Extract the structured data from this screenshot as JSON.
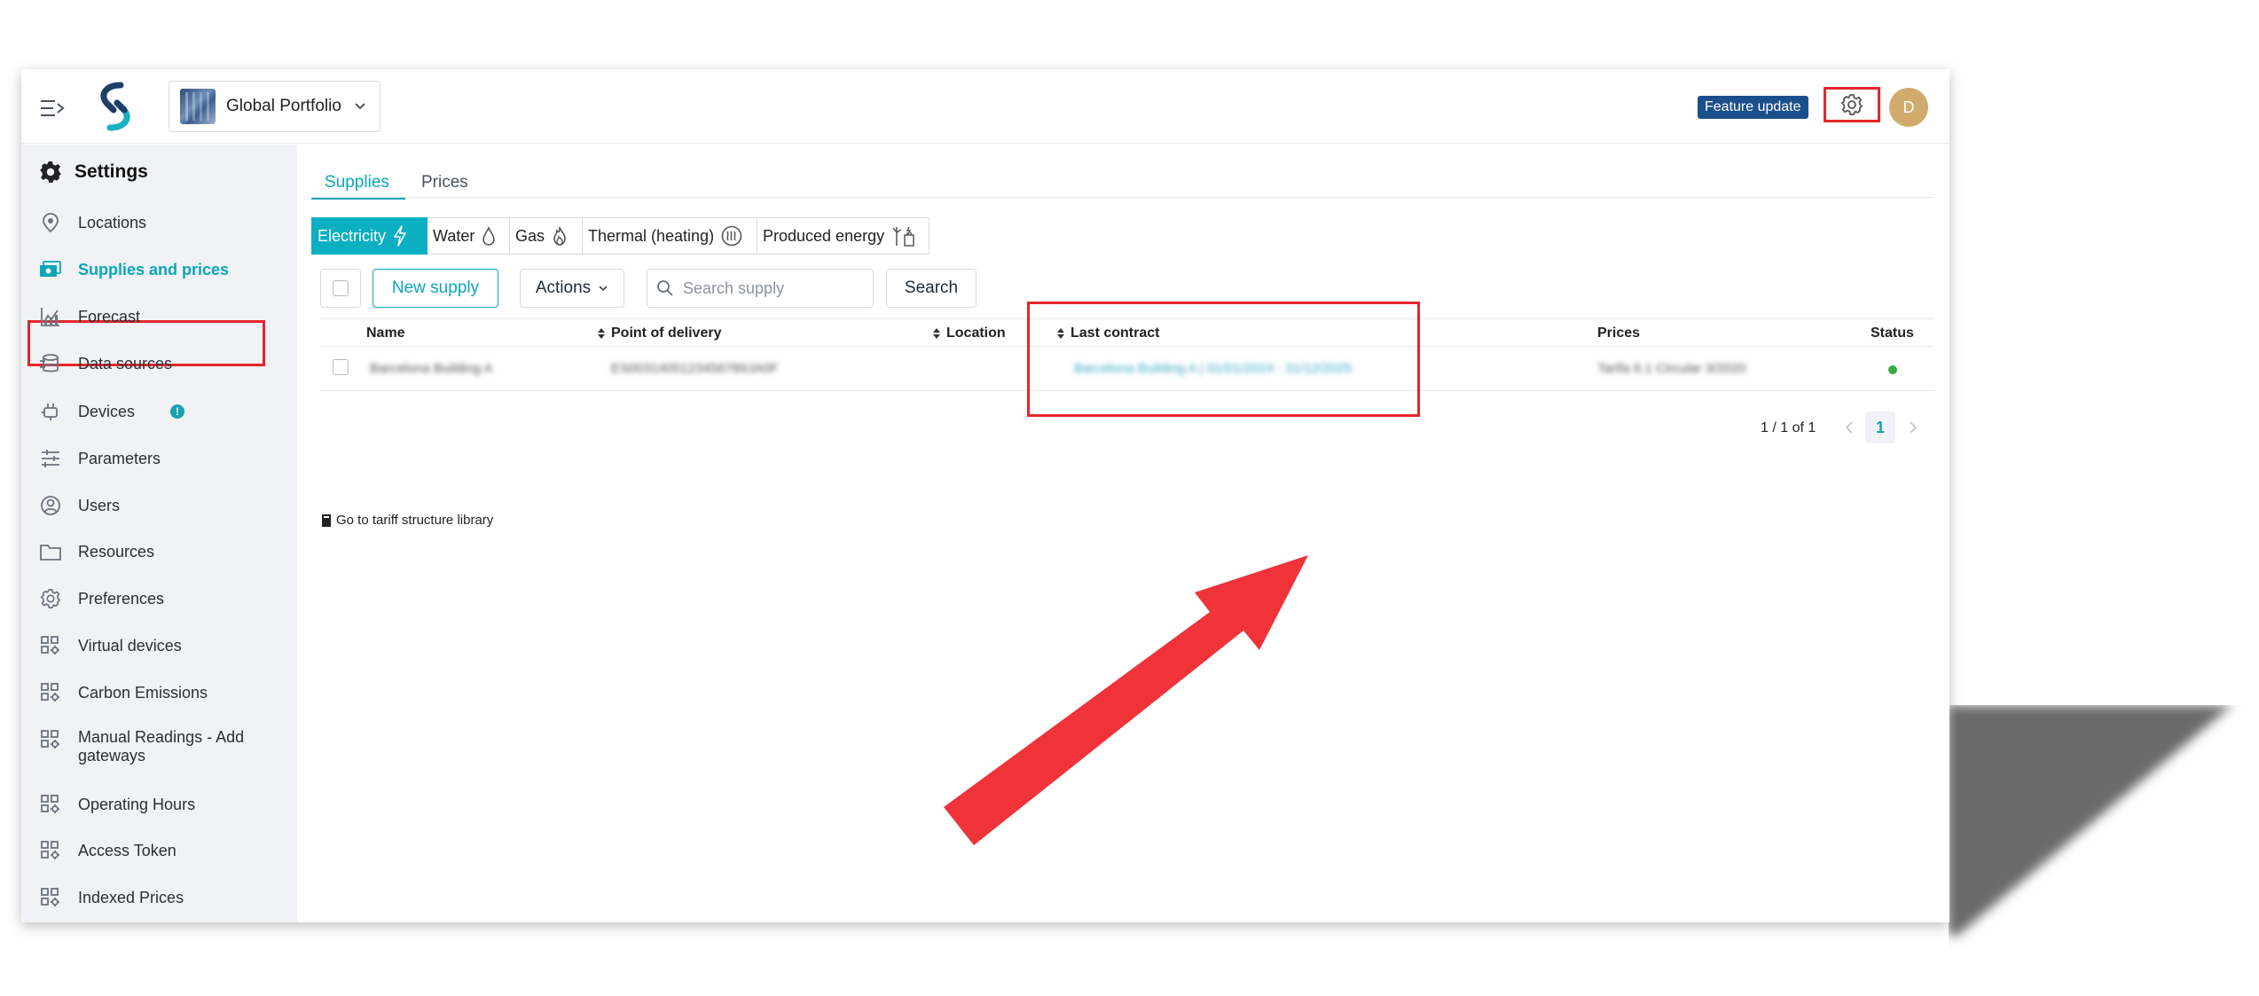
{
  "header": {
    "portfolio": "Global Portfolio",
    "feature_badge": "Feature update",
    "avatar_initial": "D"
  },
  "sidebar": {
    "title": "Settings",
    "items": [
      {
        "label": "Locations",
        "icon": "location-pin-icon"
      },
      {
        "label": "Supplies and prices",
        "icon": "money-icon",
        "active": true
      },
      {
        "label": "Forecast",
        "icon": "chart-icon"
      },
      {
        "label": "Data sources",
        "icon": "database-icon"
      },
      {
        "label": "Devices",
        "icon": "plug-icon",
        "alert": "!"
      },
      {
        "label": "Parameters",
        "icon": "sliders-icon"
      },
      {
        "label": "Users",
        "icon": "user-circle-icon"
      },
      {
        "label": "Resources",
        "icon": "folder-icon"
      },
      {
        "label": "Preferences",
        "icon": "gear-icon"
      },
      {
        "label": "Virtual devices",
        "icon": "grid-gear-icon"
      },
      {
        "label": "Carbon Emissions",
        "icon": "grid-gear-icon"
      },
      {
        "label": "Manual Readings - Add gateways",
        "icon": "grid-gear-icon"
      },
      {
        "label": "Operating Hours",
        "icon": "grid-gear-icon"
      },
      {
        "label": "Access Token",
        "icon": "grid-gear-icon"
      },
      {
        "label": "Indexed Prices",
        "icon": "grid-gear-icon"
      }
    ]
  },
  "tabs": [
    {
      "label": "Supplies",
      "active": true
    },
    {
      "label": "Prices",
      "active": false
    }
  ],
  "energy_types": [
    {
      "label": "Electricity",
      "icon": "lightning-icon",
      "active": true
    },
    {
      "label": "Water",
      "icon": "droplet-icon"
    },
    {
      "label": "Gas",
      "icon": "flame-icon"
    },
    {
      "label": "Thermal (heating)",
      "icon": "heat-icon"
    },
    {
      "label": "Produced energy",
      "icon": "produced-energy-icon"
    }
  ],
  "toolbar": {
    "new_supply": "New supply",
    "actions": "Actions",
    "search_placeholder": "Search supply",
    "search_button": "Search"
  },
  "table": {
    "columns": [
      "Name",
      "Point of delivery",
      "Location",
      "Last contract",
      "Prices",
      "Status"
    ],
    "rows": [
      {
        "name": "Barcelona Building A",
        "pod": "ES0031405123456789JA0F",
        "location": "",
        "last_contract": "Barcelona Building A | 01/01/2024 - 31/12/2025",
        "prices": "Tarifa 6.1 Circular 3/2020",
        "status": "active"
      }
    ]
  },
  "pagination": {
    "summary": "1 / 1 of 1",
    "current_page": "1"
  },
  "tariff_link": "Go to tariff structure library",
  "colors": {
    "accent": "#0aa6b8",
    "highlight": "#e3262a",
    "badge": "#1b4f8c",
    "avatar": "#d0ab6c"
  }
}
